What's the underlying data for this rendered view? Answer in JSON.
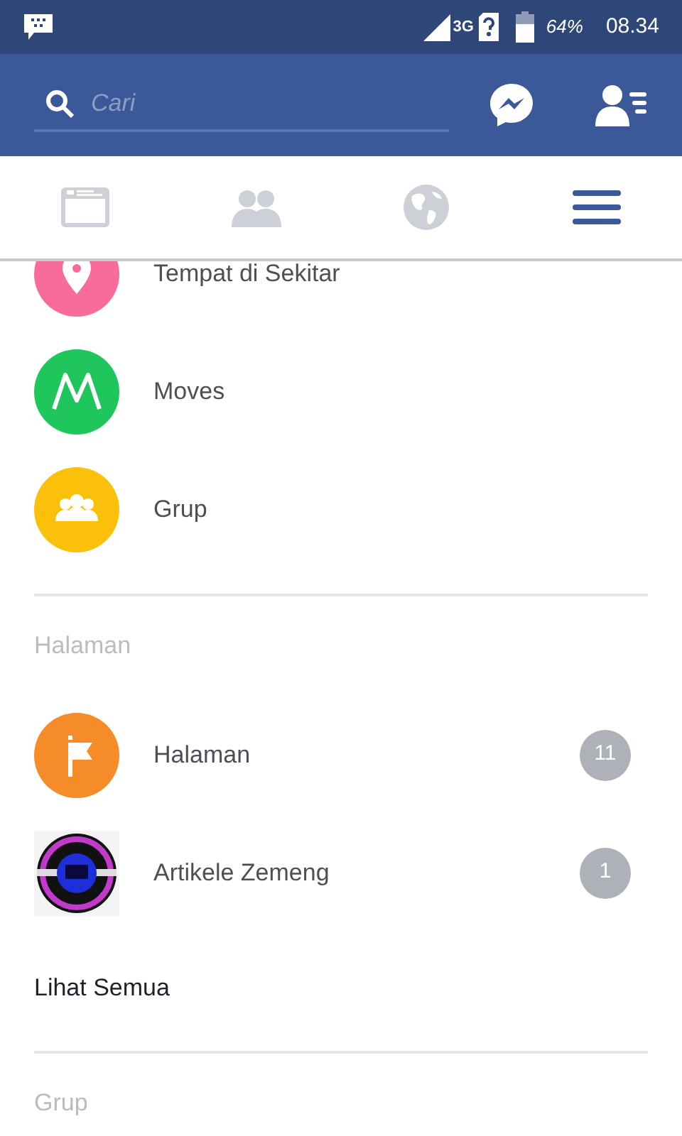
{
  "status_bar": {
    "network": "3G",
    "battery": "64%",
    "time": "08.34"
  },
  "search": {
    "placeholder": "Cari"
  },
  "tabs": [
    {
      "kind": "feed",
      "selected": false
    },
    {
      "kind": "friends",
      "selected": false
    },
    {
      "kind": "globe",
      "selected": false
    },
    {
      "kind": "menu",
      "selected": true
    }
  ],
  "sections": [
    {
      "items": [
        {
          "kind": "place",
          "label": "Tempat di Sekitar",
          "color": "#f76c9a"
        },
        {
          "kind": "moves",
          "label": "Moves",
          "color": "#1fc65c"
        },
        {
          "kind": "groups",
          "label": "Grup",
          "color": "#fbc10a"
        }
      ]
    },
    {
      "title": "Halaman",
      "items": [
        {
          "kind": "pages",
          "label": "Halaman",
          "color": "#f68b2a",
          "badge": "11"
        },
        {
          "kind": "picture",
          "label": "Artikele Zemeng",
          "badge": "1"
        }
      ],
      "link": "Lihat Semua"
    },
    {
      "title": "Grup"
    }
  ]
}
